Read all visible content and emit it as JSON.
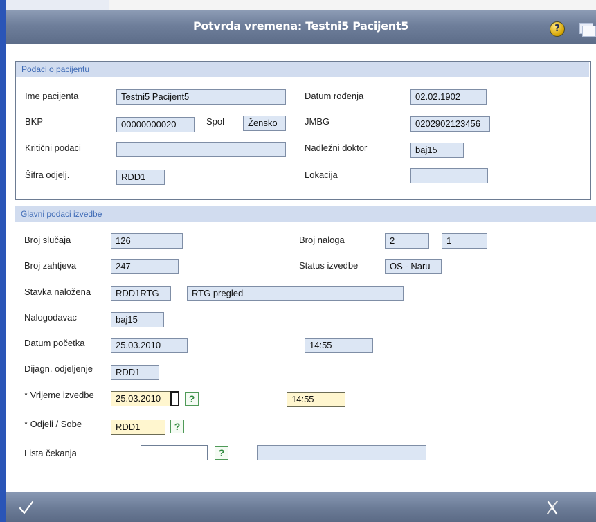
{
  "window": {
    "title": "Potvrda vremena: Testni5 Pacijent5"
  },
  "icons": {
    "help": "help-icon",
    "help_glyph": "?",
    "window": "window-icon",
    "ok": "checkmark-icon",
    "cancel": "cancel-x-icon"
  },
  "patient": {
    "header": "Podaci o pacijentu",
    "name_label": "Ime pacijenta",
    "name_value": "Testni5 Pacijent5",
    "dob_label": "Datum rođenja",
    "dob_value": "02.02.1902",
    "bkp_label": "BKP",
    "bkp_value": "00000000020",
    "sex_label": "Spol",
    "sex_value": "Žensko",
    "jmbg_label": "JMBG",
    "jmbg_value": "0202902123456",
    "critical_label": "Kritični podaci",
    "critical_value": "",
    "doctor_label": "Nadležni doktor",
    "doctor_value": "baj15",
    "dept_code_label": "Šifra odjelj.",
    "dept_code_value": "RDD1",
    "location_label": "Lokacija",
    "location_value": ""
  },
  "execution": {
    "header": "Glavni podaci izvedbe",
    "case_no_label": "Broj slučaja",
    "case_no_value": "126",
    "order_no_label": "Broj naloga",
    "order_no_value_1": "2",
    "order_no_value_2": "1",
    "request_no_label": "Broj zahtjeva",
    "request_no_value": "247",
    "status_label": "Status izvedbe",
    "status_value": "OS - Naru",
    "item_label": "Stavka naložena",
    "item_code": "RDD1RTG",
    "item_desc": "RTG pregled",
    "orderer_label": "Nalogodavac",
    "orderer_value": "baj15",
    "start_date_label": "Datum početka",
    "start_date_value": "25.03.2010",
    "start_time_value": "14:55",
    "diag_dept_label": "Dijagn. odjeljenje",
    "diag_dept_value": "RDD1",
    "exec_time_label": "* Vrijeme izvedbe",
    "exec_date_value": "25.03.2010",
    "exec_time_value": "14:55",
    "rooms_label": "* Odjeli / Sobe",
    "rooms_value": "RDD1",
    "waitlist_label": "Lista čekanja",
    "waitlist_value": "",
    "waitlist_desc_value": "",
    "lookup_glyph": "?"
  },
  "colors": {
    "title_bar": "#6f7f9b",
    "section_header": "#d1dcef",
    "section_header_text": "#3f6bb6",
    "field_readonly": "#dce6f4",
    "field_mandatory": "#fff6cf",
    "lookup_button": "#4f9a58"
  }
}
